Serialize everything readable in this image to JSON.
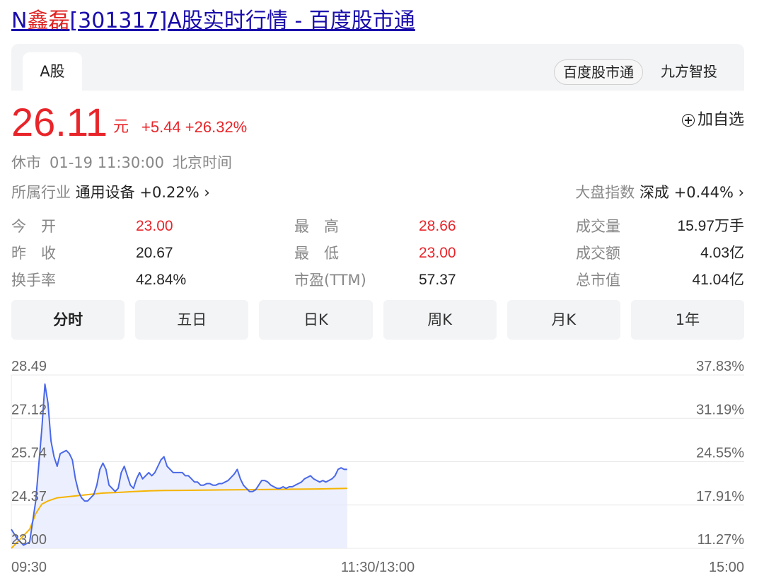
{
  "page": {
    "title_prefix": "N",
    "title_highlight": "鑫磊",
    "title_rest": "[301317]A股实时行情 - 百度股市通"
  },
  "tabs": {
    "market": "A股",
    "source_1": "百度股市通",
    "source_2": "九方智投"
  },
  "quote": {
    "price": "26.11",
    "unit": "元",
    "change": "+5.44 +26.32%",
    "add_watch": "加自选",
    "status": "休市",
    "datetime": "01-19 11:30:00",
    "timezone": "北京时间",
    "industry_label": "所属行业",
    "industry_value": "通用设备 +0.22% ›",
    "index_label": "大盘指数",
    "index_value": "深成 +0.44% ›"
  },
  "stats": [
    [
      {
        "label": "今　开",
        "value": "23.00",
        "color": "red"
      },
      {
        "label": "最　高",
        "value": "28.66",
        "color": "red"
      },
      {
        "label": "成交量",
        "value": "15.97万手",
        "color": "dark"
      }
    ],
    [
      {
        "label": "昨　收",
        "value": "20.67",
        "color": "dark"
      },
      {
        "label": "最　低",
        "value": "23.00",
        "color": "red"
      },
      {
        "label": "成交额",
        "value": "4.03亿",
        "color": "dark"
      }
    ],
    [
      {
        "label": "换手率",
        "value": "42.84%",
        "color": "dark"
      },
      {
        "label": "市盈(TTM)",
        "value": "57.37",
        "color": "dark"
      },
      {
        "label": "总市值",
        "value": "41.04亿",
        "color": "dark"
      }
    ]
  ],
  "period_tabs": [
    "分时",
    "五日",
    "日K",
    "周K",
    "月K",
    "1年"
  ],
  "chart_data": {
    "type": "line",
    "y_left_ticks": [
      "28.49",
      "27.12",
      "25.74",
      "24.37",
      "23.00"
    ],
    "y_right_ticks": [
      "37.83%",
      "31.19%",
      "24.55%",
      "17.91%",
      "11.27%"
    ],
    "x_ticks": [
      "09:30",
      "11:30/13:00",
      "15:00"
    ],
    "ylim": [
      23.0,
      28.49
    ],
    "x_minutes_total": 240,
    "colors": {
      "price": "#4a68e8",
      "avg": "#f5b400",
      "fill": "#e6eafc"
    },
    "price": [
      [
        0,
        23.6
      ],
      [
        2,
        23.3
      ],
      [
        4,
        23.1
      ],
      [
        6,
        23.2
      ],
      [
        8,
        24.5
      ],
      [
        10,
        26.8
      ],
      [
        11,
        28.2
      ],
      [
        12,
        27.6
      ],
      [
        13,
        26.4
      ],
      [
        14,
        25.9
      ],
      [
        15,
        25.6
      ],
      [
        16,
        26.0
      ],
      [
        18,
        26.1
      ],
      [
        19,
        26.0
      ],
      [
        20,
        25.8
      ],
      [
        21,
        25.2
      ],
      [
        22,
        24.8
      ],
      [
        23,
        24.6
      ],
      [
        24,
        24.5
      ],
      [
        25,
        24.5
      ],
      [
        26,
        24.6
      ],
      [
        27,
        24.7
      ],
      [
        28,
        25.0
      ],
      [
        29,
        25.5
      ],
      [
        30,
        25.7
      ],
      [
        31,
        25.5
      ],
      [
        32,
        25.0
      ],
      [
        33,
        24.9
      ],
      [
        34,
        24.8
      ],
      [
        35,
        24.9
      ],
      [
        36,
        25.4
      ],
      [
        37,
        25.6
      ],
      [
        38,
        25.3
      ],
      [
        39,
        25.0
      ],
      [
        40,
        24.9
      ],
      [
        41,
        25.2
      ],
      [
        42,
        25.4
      ],
      [
        43,
        25.2
      ],
      [
        44,
        25.3
      ],
      [
        45,
        25.4
      ],
      [
        46,
        25.3
      ],
      [
        47,
        25.4
      ],
      [
        48,
        25.6
      ],
      [
        49,
        25.8
      ],
      [
        50,
        25.9
      ],
      [
        51,
        25.6
      ],
      [
        52,
        25.5
      ],
      [
        53,
        25.4
      ],
      [
        54,
        25.4
      ],
      [
        55,
        25.4
      ],
      [
        56,
        25.4
      ],
      [
        57,
        25.3
      ],
      [
        58,
        25.3
      ],
      [
        59,
        25.2
      ],
      [
        60,
        25.1
      ],
      [
        61,
        25.1
      ],
      [
        62,
        25.0
      ],
      [
        63,
        25.0
      ],
      [
        64,
        25.05
      ],
      [
        65,
        25.05
      ],
      [
        66,
        25.0
      ],
      [
        67,
        25.0
      ],
      [
        68,
        25.05
      ],
      [
        69,
        25.05
      ],
      [
        70,
        25.1
      ],
      [
        71,
        25.15
      ],
      [
        72,
        25.25
      ],
      [
        73,
        25.35
      ],
      [
        74,
        25.5
      ],
      [
        75,
        25.2
      ],
      [
        76,
        25.0
      ],
      [
        77,
        24.9
      ],
      [
        78,
        24.8
      ],
      [
        79,
        24.8
      ],
      [
        80,
        24.85
      ],
      [
        81,
        25.0
      ],
      [
        82,
        25.15
      ],
      [
        83,
        25.15
      ],
      [
        84,
        25.1
      ],
      [
        85,
        25.0
      ],
      [
        86,
        24.95
      ],
      [
        87,
        24.9
      ],
      [
        88,
        24.9
      ],
      [
        89,
        24.95
      ],
      [
        90,
        24.9
      ],
      [
        91,
        24.95
      ],
      [
        92,
        24.95
      ],
      [
        93,
        25.0
      ],
      [
        94,
        25.05
      ],
      [
        95,
        25.1
      ],
      [
        96,
        25.2
      ],
      [
        97,
        25.25
      ],
      [
        98,
        25.3
      ],
      [
        99,
        25.2
      ],
      [
        100,
        25.15
      ],
      [
        101,
        25.1
      ],
      [
        102,
        25.15
      ],
      [
        103,
        25.1
      ],
      [
        104,
        25.15
      ],
      [
        105,
        25.2
      ],
      [
        106,
        25.3
      ],
      [
        107,
        25.5
      ],
      [
        108,
        25.55
      ],
      [
        109,
        25.5
      ],
      [
        110,
        25.5
      ]
    ],
    "avg": [
      [
        0,
        23.0
      ],
      [
        3,
        23.3
      ],
      [
        6,
        23.6
      ],
      [
        8,
        24.1
      ],
      [
        10,
        24.4
      ],
      [
        12,
        24.5
      ],
      [
        15,
        24.6
      ],
      [
        20,
        24.65
      ],
      [
        25,
        24.7
      ],
      [
        30,
        24.75
      ],
      [
        35,
        24.77
      ],
      [
        40,
        24.8
      ],
      [
        45,
        24.82
      ],
      [
        50,
        24.83
      ],
      [
        60,
        24.84
      ],
      [
        70,
        24.85
      ],
      [
        80,
        24.86
      ],
      [
        90,
        24.87
      ],
      [
        100,
        24.88
      ],
      [
        110,
        24.9
      ]
    ]
  }
}
